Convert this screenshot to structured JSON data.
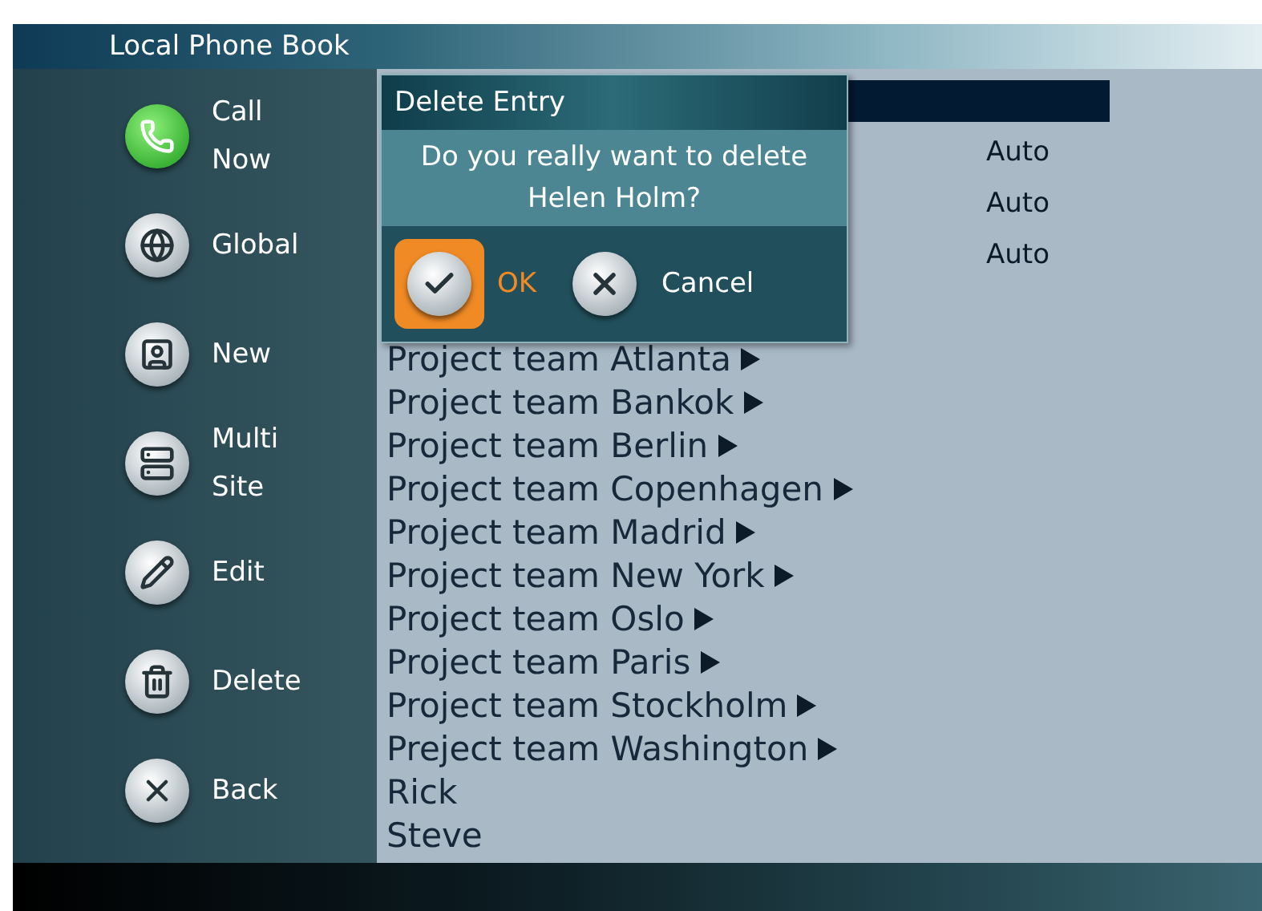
{
  "window": {
    "title": "Local Phone Book"
  },
  "sidebar": {
    "items": [
      {
        "kind": "call",
        "label": "Call Now"
      },
      {
        "kind": "global",
        "label": "Global"
      },
      {
        "kind": "new",
        "label": "New"
      },
      {
        "kind": "multisite",
        "label": "Multi Site"
      },
      {
        "kind": "edit",
        "label": "Edit"
      },
      {
        "kind": "delete",
        "label": "Delete"
      },
      {
        "kind": "back",
        "label": "Back"
      }
    ]
  },
  "hidden_rows": [
    {
      "selected": true
    },
    {
      "selected": false,
      "column_2": "Auto"
    },
    {
      "selected": false,
      "column_2": "Auto"
    },
    {
      "selected": false,
      "column_2": "Auto"
    }
  ],
  "entries": [
    {
      "name": "Project team Atlanta",
      "submenu": true
    },
    {
      "name": "Project team Bankok",
      "submenu": true
    },
    {
      "name": "Project team Berlin",
      "submenu": true
    },
    {
      "name": "Project team Copenhagen",
      "submenu": true
    },
    {
      "name": "Project team Madrid",
      "submenu": true
    },
    {
      "name": "Project team New York",
      "submenu": true
    },
    {
      "name": "Project team Oslo",
      "submenu": true
    },
    {
      "name": "Project team Paris",
      "submenu": true
    },
    {
      "name": "Project team Stockholm",
      "submenu": true
    },
    {
      "name": "Preject team Washington",
      "submenu": true
    },
    {
      "name": "Rick",
      "submenu": false
    },
    {
      "name": "Steve",
      "submenu": false
    }
  ],
  "dialog": {
    "title": "Delete Entry",
    "message": "Do you really want to delete",
    "subject": "Helen Holm?",
    "buttons": [
      {
        "kind": "ok",
        "label": "OK",
        "selected": true
      },
      {
        "kind": "cancel",
        "label": "Cancel",
        "selected": false
      }
    ]
  }
}
